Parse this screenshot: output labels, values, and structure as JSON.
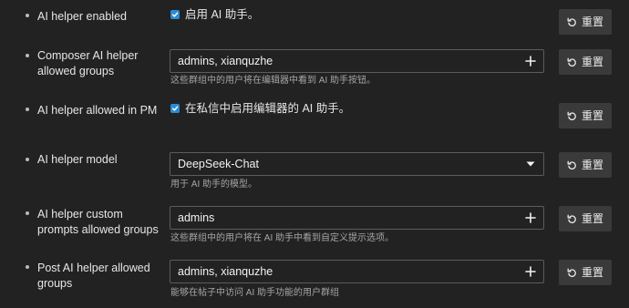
{
  "reset_label": "重置",
  "settings": [
    {
      "label": "AI helper enabled",
      "control": "checkbox",
      "checked": true,
      "checkbox_label": "启用 AI 助手。"
    },
    {
      "label": "Composer AI helper allowed groups",
      "control": "multiselect",
      "value": "admins, xianquzhe",
      "icon": "plus-icon",
      "help": "这些群组中的用户将在编辑器中看到 AI 助手按钮。"
    },
    {
      "label": "AI helper allowed in PM",
      "control": "checkbox",
      "checked": true,
      "checkbox_label": "在私信中启用编辑器的 AI 助手。"
    },
    {
      "label": "AI helper model",
      "control": "select",
      "value": "DeepSeek-Chat",
      "icon": "caret-down-icon",
      "help": "用于 AI 助手的模型。"
    },
    {
      "label": "AI helper custom prompts allowed groups",
      "control": "multiselect",
      "value": "admins",
      "icon": "plus-icon",
      "help": "这些群组中的用户将在 AI 助手中看到自定义提示选项。"
    },
    {
      "label": "Post AI helper allowed groups",
      "control": "multiselect",
      "value": "admins, xianquzhe",
      "icon": "plus-icon",
      "help": "能够在帖子中访问 AI 助手功能的用户群组"
    }
  ],
  "colors": {
    "background": "#222222",
    "checkbox": "#2d8bd2",
    "button": "#3a3a3a",
    "field_border": "#5c5c5c",
    "help_text": "#a6a6a6"
  }
}
